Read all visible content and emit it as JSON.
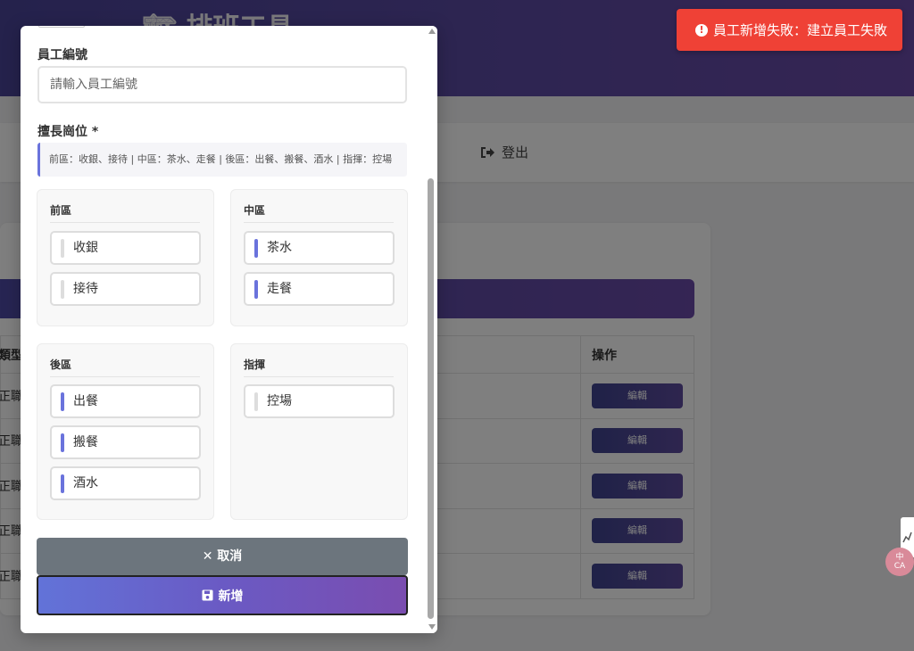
{
  "background": {
    "app_title": "🏗 排班工具",
    "logout_label": "登出",
    "table": {
      "col_type": "類型",
      "col_action": "操作",
      "rows": [
        {
          "type": "正職",
          "edit": "編輯"
        },
        {
          "type": "正職",
          "edit": "編輯"
        },
        {
          "type": "正職",
          "edit": "編輯"
        },
        {
          "type": "正職",
          "edit": "編輯"
        },
        {
          "type": "正職",
          "edit": "編輯"
        }
      ]
    }
  },
  "toast": {
    "message": "員工新增失敗：建立員工失敗",
    "color": "#ef4136"
  },
  "modal": {
    "employee_id_label": "員工編號",
    "employee_id_placeholder": "請輸入員工編號",
    "employee_id_value": "",
    "positions_label": "擅長崗位 *",
    "positions_hint": "前區：收銀、接待 | 中區：茶水、走餐 | 後區：出餐、搬餐、酒水 | 指揮：控場",
    "groups": [
      {
        "title": "前區",
        "items": [
          {
            "label": "收銀",
            "selected": false
          },
          {
            "label": "接待",
            "selected": false
          }
        ]
      },
      {
        "title": "中區",
        "items": [
          {
            "label": "茶水",
            "selected": true
          },
          {
            "label": "走餐",
            "selected": true
          }
        ]
      },
      {
        "title": "後區",
        "items": [
          {
            "label": "出餐",
            "selected": true
          },
          {
            "label": "搬餐",
            "selected": true
          },
          {
            "label": "酒水",
            "selected": true
          }
        ]
      },
      {
        "title": "指揮",
        "items": [
          {
            "label": "控場",
            "selected": false
          }
        ]
      }
    ],
    "cancel_label": "取消",
    "add_label": "新增",
    "accent_color": "#6a73dc"
  },
  "side_badge": "中\nCA"
}
